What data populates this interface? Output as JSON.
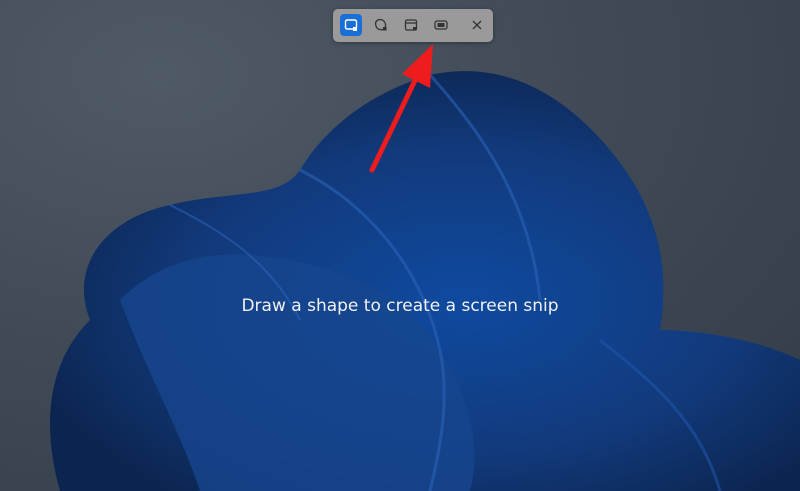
{
  "toolbar": {
    "modes": [
      {
        "name": "rectangle-mode",
        "icon": "rectangle-snip-icon",
        "active": true
      },
      {
        "name": "freeform-mode",
        "icon": "freeform-snip-icon",
        "active": false
      },
      {
        "name": "window-mode",
        "icon": "window-snip-icon",
        "active": false
      },
      {
        "name": "fullscreen-mode",
        "icon": "fullscreen-snip-icon",
        "active": false
      }
    ],
    "close_icon": "close-icon"
  },
  "hint_text": "Draw a shape to create a screen snip",
  "colors": {
    "accent": "#1a6fd6",
    "arrow": "#ee1c1c",
    "wallpaper": "#0f3a80"
  }
}
